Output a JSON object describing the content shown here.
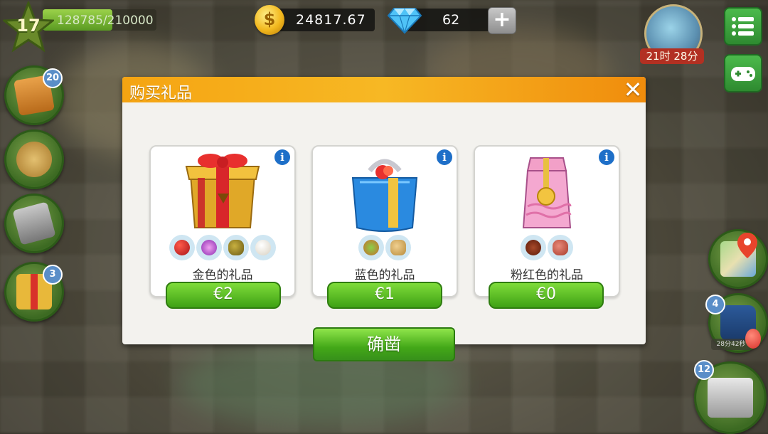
{
  "hud": {
    "level": "17",
    "xp": "128785/210000",
    "xp_progress": 0.61,
    "coins": "24817.67",
    "gems": "62",
    "plus": "+",
    "timer": "21时 28分"
  },
  "side_left": [
    {
      "name": "recipe-book",
      "badge": "20"
    },
    {
      "name": "cooking-pot",
      "badge": ""
    },
    {
      "name": "telephone",
      "badge": ""
    },
    {
      "name": "gift-box",
      "badge": "3"
    }
  ],
  "side_right": [
    {
      "name": "map",
      "badge": ""
    },
    {
      "name": "coffee-cup",
      "badge": "4",
      "sub_label": "28分42秒"
    },
    {
      "name": "cash-register",
      "badge": "12"
    }
  ],
  "dialog": {
    "title": "购买礼品",
    "close": "✕",
    "confirm": "确凿",
    "cards": [
      {
        "name": "金色的礼品",
        "price": "€2",
        "info": "i",
        "color": "gold",
        "ingredients": [
          "red-fruit",
          "purple-flower",
          "cocoa-bean",
          "eggs"
        ]
      },
      {
        "name": "蓝色的礼品",
        "price": "€1",
        "info": "i",
        "color": "blue",
        "ingredients": [
          "herbs",
          "ginger"
        ]
      },
      {
        "name": "粉红色的礼品",
        "price": "€0",
        "info": "i",
        "color": "pink",
        "ingredients": [
          "star-anise",
          "meat"
        ]
      }
    ]
  },
  "colors": {
    "header_orange": "#f5a412",
    "button_green": "#43a818",
    "info_blue": "#1e6fc8",
    "timer_red": "#b23022"
  }
}
